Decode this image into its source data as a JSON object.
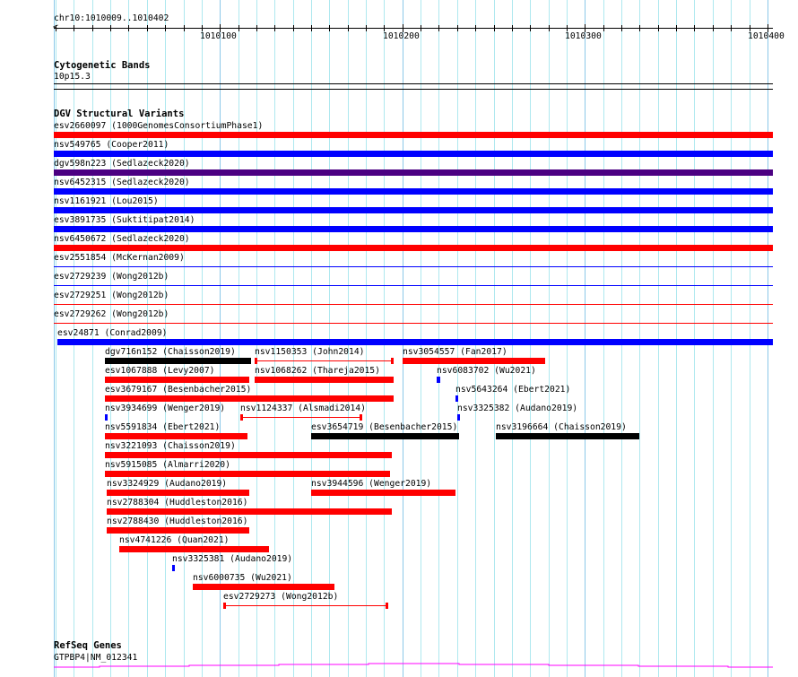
{
  "ruler": {
    "position_label": "chr10:1010009..1010402",
    "start": 1010009,
    "end": 1010403,
    "tick_labels": [
      "1010100",
      "1010200",
      "1010300",
      "1010400"
    ]
  },
  "tracks": {
    "cytobands": {
      "title": "Cytogenetic Bands",
      "band": "10p15.3"
    },
    "dgv": {
      "title": "DGV Structural Variants"
    },
    "refseq": {
      "title": "RefSeq Genes",
      "gene": "GTPBP4|NM_012341",
      "color": "#ff00ff"
    }
  },
  "colors": {
    "red": "#ff0000",
    "blue": "#0000ff",
    "purple": "#4b0082",
    "black": "#000000"
  },
  "full_rows": [
    {
      "label": "esv2660097 (1000GenomesConsortiumPhase1)",
      "color": "red",
      "style": "thick",
      "start": 1010009,
      "end": 1010403
    },
    {
      "label": "nsv549765 (Cooper2011)",
      "color": "blue",
      "style": "thick",
      "start": 1010009,
      "end": 1010403
    },
    {
      "label": "dgv598n223 (Sedlazeck2020)",
      "color": "purple",
      "style": "thick",
      "start": 1010009,
      "end": 1010403
    },
    {
      "label": "nsv6452315 (Sedlazeck2020)",
      "color": "blue",
      "style": "thick",
      "start": 1010009,
      "end": 1010403
    },
    {
      "label": "nsv1161921 (Lou2015)",
      "color": "blue",
      "style": "thick",
      "start": 1010009,
      "end": 1010403
    },
    {
      "label": "esv3891735 (Suktitipat2014)",
      "color": "blue",
      "style": "thick",
      "start": 1010009,
      "end": 1010403
    },
    {
      "label": "nsv6450672 (Sedlazeck2020)",
      "color": "red",
      "style": "thick",
      "start": 1010009,
      "end": 1010403
    },
    {
      "label": "esv2551854 (McKernan2009)",
      "color": "blue",
      "style": "thin",
      "start": 1010009,
      "end": 1010403
    },
    {
      "label": "esv2729239 (Wong2012b)",
      "color": "blue",
      "style": "thin",
      "start": 1010009,
      "end": 1010403
    },
    {
      "label": "esv2729251 (Wong2012b)",
      "color": "red",
      "style": "thin",
      "start": 1010009,
      "end": 1010403
    },
    {
      "label": "esv2729262 (Wong2012b)",
      "color": "red",
      "style": "thin",
      "start": 1010009,
      "end": 1010403
    },
    {
      "label": "esv24871 (Conrad2009)",
      "color": "blue",
      "style": "thick",
      "start": 1010011,
      "end": 1010403
    }
  ],
  "packed_rows": [
    [
      {
        "label": "dgv716n152 (Chaisson2019)",
        "color": "black",
        "style": "thick",
        "start": 1010037,
        "end": 1010117
      },
      {
        "label": "nsv1150353 (John2014)",
        "color": "red",
        "style": "capped",
        "start": 1010119,
        "end": 1010195
      },
      {
        "label": "nsv3054557 (Fan2017)",
        "color": "red",
        "style": "thick",
        "start": 1010200,
        "end": 1010278
      }
    ],
    [
      {
        "label": "esv1067888 (Levy2007)",
        "color": "red",
        "style": "thick",
        "start": 1010037,
        "end": 1010116
      },
      {
        "label": "nsv1068262 (Thareja2015)",
        "color": "red",
        "style": "thick",
        "start": 1010119,
        "end": 1010195
      },
      {
        "label": "nsv6083702 (Wu2021)",
        "color": "blue",
        "style": "thick",
        "start": 1010219,
        "end": 1010220.5
      }
    ],
    [
      {
        "label": "esv3679167 (Besenbacher2015)",
        "color": "red",
        "style": "thick",
        "start": 1010037,
        "end": 1010195
      },
      {
        "label": "nsv5643264 (Ebert2021)",
        "color": "blue",
        "style": "thick",
        "start": 1010229,
        "end": 1010230.5
      }
    ],
    [
      {
        "label": "nsv3934699 (Wenger2019)",
        "color": "blue",
        "style": "thick",
        "start": 1010037,
        "end": 1010038.5
      },
      {
        "label": "nsv1124337 (Alsmadi2014)",
        "color": "red",
        "style": "capped",
        "start": 1010111,
        "end": 1010178
      },
      {
        "label": "nsv3325382 (Audano2019)",
        "color": "blue",
        "style": "thick",
        "start": 1010230,
        "end": 1010231.5
      }
    ],
    [
      {
        "label": "nsv5591834 (Ebert2021)",
        "color": "red",
        "style": "thick",
        "start": 1010037,
        "end": 1010115
      },
      {
        "label": "esv3654719 (Besenbacher2015)",
        "color": "black",
        "style": "thick",
        "start": 1010150,
        "end": 1010231
      },
      {
        "label": "nsv3196664 (Chaisson2019)",
        "color": "black",
        "style": "thick",
        "start": 1010251,
        "end": 1010330
      }
    ],
    [
      {
        "label": "nsv3221093 (Chaisson2019)",
        "color": "red",
        "style": "thick",
        "start": 1010037,
        "end": 1010194
      }
    ],
    [
      {
        "label": "nsv5915085 (Almarri2020)",
        "color": "red",
        "style": "thick",
        "start": 1010037,
        "end": 1010193
      }
    ],
    [
      {
        "label": "nsv3324929 (Audano2019)",
        "color": "red",
        "style": "thick",
        "start": 1010038,
        "end": 1010116
      },
      {
        "label": "nsv3944596 (Wenger2019)",
        "color": "red",
        "style": "thick",
        "start": 1010150,
        "end": 1010229
      }
    ],
    [
      {
        "label": "nsv2788304 (Huddleston2016)",
        "color": "red",
        "style": "thick",
        "start": 1010038,
        "end": 1010194
      }
    ],
    [
      {
        "label": "nsv2788430 (Huddleston2016)",
        "color": "red",
        "style": "thick",
        "start": 1010038,
        "end": 1010116
      }
    ],
    [
      {
        "label": "nsv4741226 (Quan2021)",
        "color": "red",
        "style": "thick",
        "start": 1010045,
        "end": 1010127
      }
    ],
    [
      {
        "label": "nsv3325381 (Audano2019)",
        "color": "blue",
        "style": "thick",
        "start": 1010074,
        "end": 1010075.5
      }
    ],
    [
      {
        "label": "nsv6000735 (Wu2021)",
        "color": "red",
        "style": "thick",
        "start": 1010085,
        "end": 1010163
      }
    ],
    [
      {
        "label": "esv2729273 (Wong2012b)",
        "color": "red",
        "style": "capped",
        "start": 1010102,
        "end": 1010192
      }
    ]
  ]
}
